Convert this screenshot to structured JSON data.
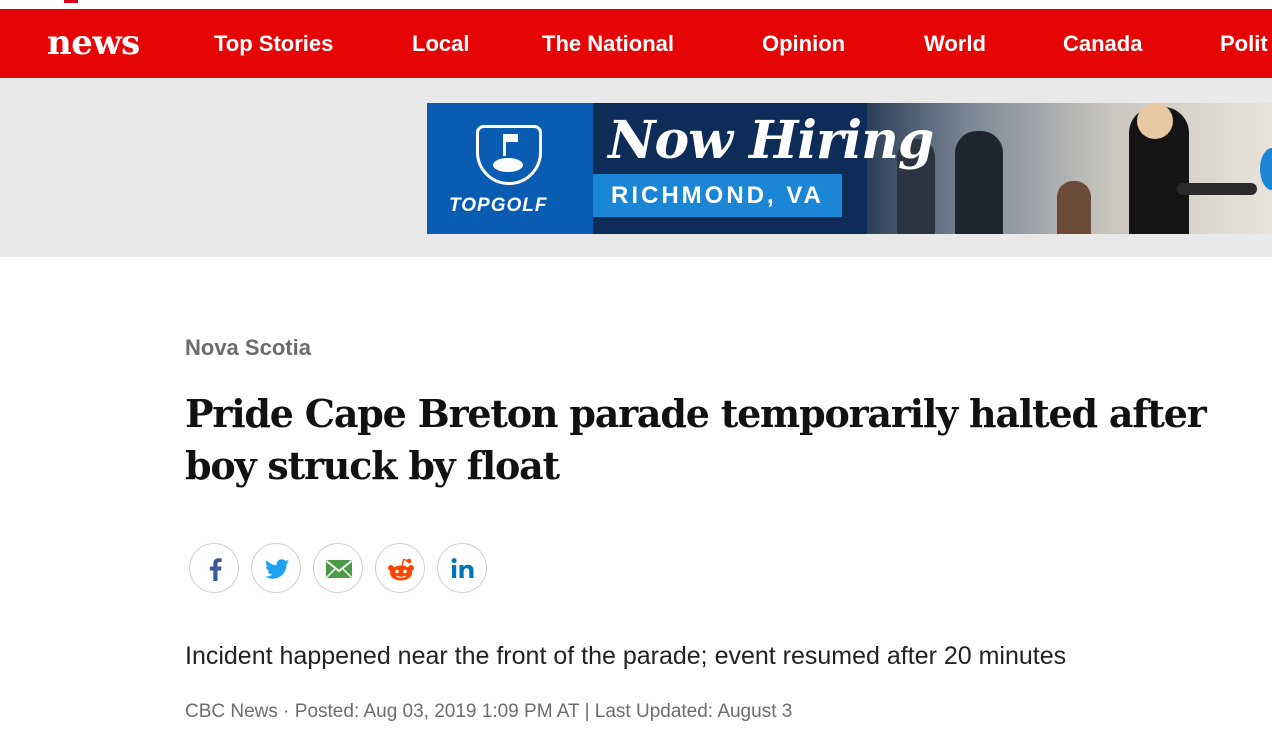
{
  "colors": {
    "brand_red": "#e60505",
    "ad_blue": "#1b86d6"
  },
  "header": {
    "logo": "news",
    "nav": [
      "Top Stories",
      "Local",
      "The National",
      "Opinion",
      "World",
      "Canada",
      "Polit"
    ]
  },
  "ad": {
    "brand": "TOPGOLF",
    "headline": "Now Hiring",
    "location": "RICHMOND, VA"
  },
  "article": {
    "section": "Nova Scotia",
    "title": "Pride Cape Breton parade temporarily halted after boy struck by float",
    "deck": "Incident happened near the front of the parade; event resumed after 20 minutes",
    "byline": "CBC News · Posted: Aug 03, 2019 1:09 PM AT | Last Updated: August 3"
  },
  "share": {
    "icons": [
      "facebook-icon",
      "twitter-icon",
      "email-icon",
      "reddit-icon",
      "linkedin-icon"
    ]
  }
}
